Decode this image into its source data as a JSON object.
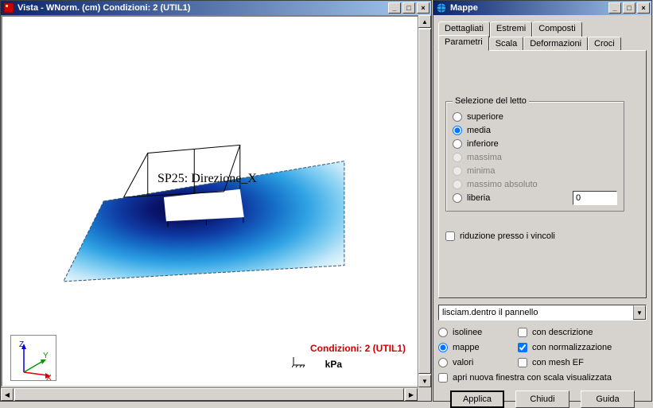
{
  "vista": {
    "title": "Vista - WNorm. (cm) Condizioni: 2 (UTIL1)",
    "overlay": "SP25: Direzione_X",
    "conditions_label": "Condizioni: 2 (UTIL1)",
    "unit": "kPa",
    "axes": {
      "x": "X",
      "y": "Y",
      "z": "Z"
    }
  },
  "mappe": {
    "title": "Mappe",
    "tabs_back": {
      "dettagliati": "Dettagliati",
      "estremi": "Estremi",
      "composti": "Composti"
    },
    "tabs_front": {
      "parametri": "Parametri",
      "scala": "Scala",
      "deformazioni": "Deformazioni",
      "croci": "Croci"
    },
    "group_title": "Selezione del letto",
    "radios": {
      "superiore": "superiore",
      "media": "media",
      "inferiore": "inferiore",
      "massima": "massima",
      "minima": "minima",
      "massimo_absoluto": "massimo absoluto",
      "liberia": "liberia"
    },
    "liberia_value": "0",
    "riduzione": "riduzione presso i vincoli",
    "combo_value": "lisciam.dentro il pannello",
    "options": {
      "isolinee": "isolinee",
      "mappe": "mappe",
      "valori": "valori",
      "descrizione": "con descrizione",
      "normalizzazione": "con normalizzazione",
      "mesh": "con mesh EF",
      "nuova_finestra": "apri nuova finestra con scala visualizzata"
    },
    "buttons": {
      "applica": "Applica",
      "chiudi": "Chiudi",
      "guida": "Guida"
    }
  }
}
